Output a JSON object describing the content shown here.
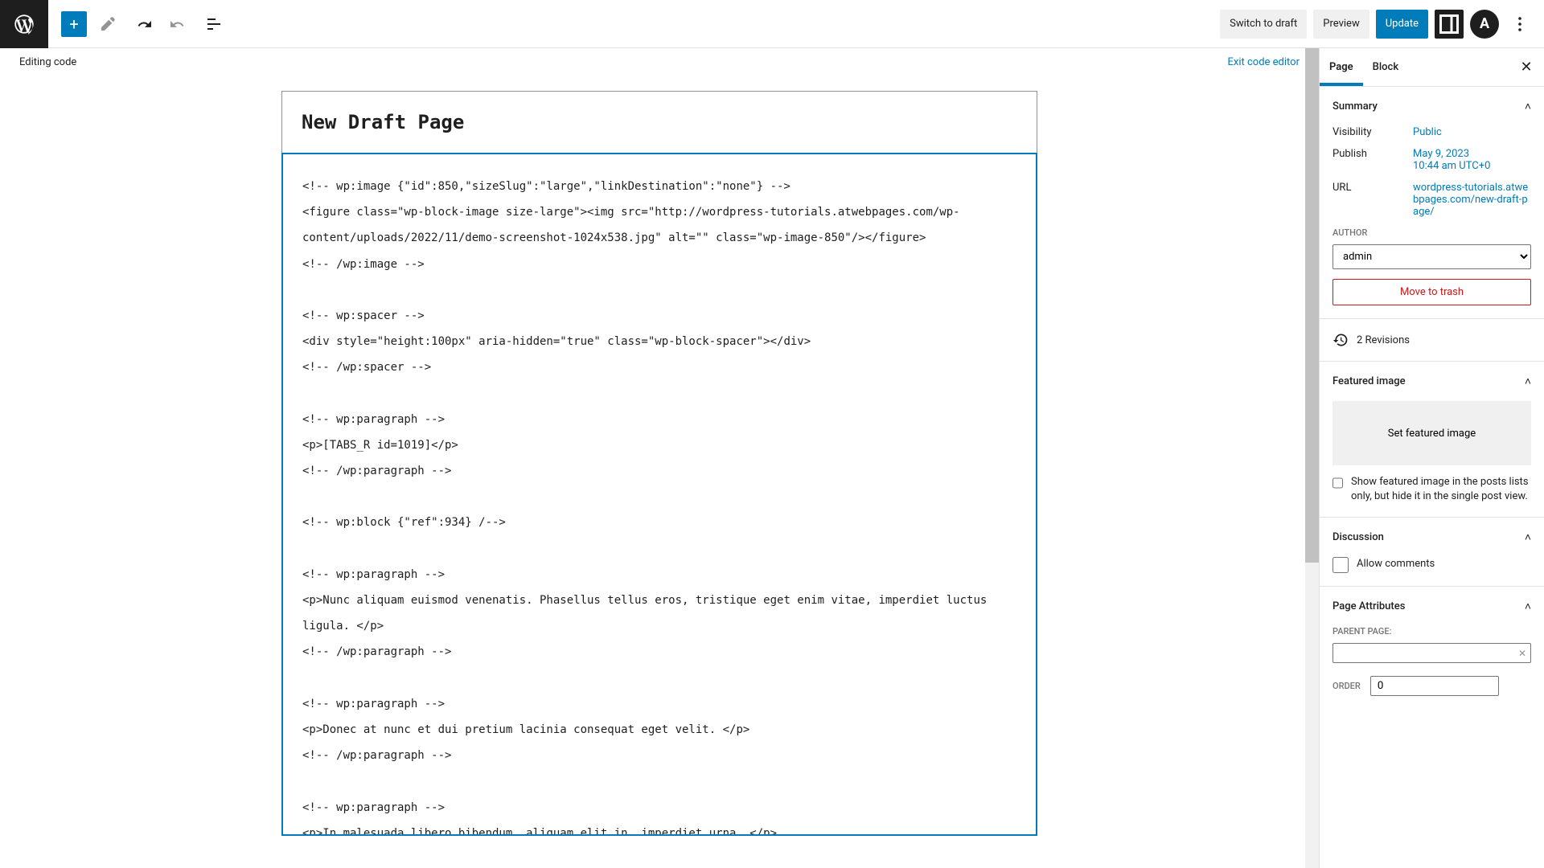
{
  "toolbar": {
    "switch_draft": "Switch to draft",
    "preview": "Preview",
    "update": "Update"
  },
  "editor": {
    "banner_left": "Editing code",
    "exit_link": "Exit code editor",
    "title": "New Draft Page",
    "code": "<!-- wp:image {\"id\":850,\"sizeSlug\":\"large\",\"linkDestination\":\"none\"} -->\n<figure class=\"wp-block-image size-large\"><img src=\"http://wordpress-tutorials.atwebpages.com/wp-content/uploads/2022/11/demo-screenshot-1024x538.jpg\" alt=\"\" class=\"wp-image-850\"/></figure>\n<!-- /wp:image -->\n\n<!-- wp:spacer -->\n<div style=\"height:100px\" aria-hidden=\"true\" class=\"wp-block-spacer\"></div>\n<!-- /wp:spacer -->\n\n<!-- wp:paragraph -->\n<p>[TABS_R id=1019]</p>\n<!-- /wp:paragraph -->\n\n<!-- wp:block {\"ref\":934} /-->\n\n<!-- wp:paragraph -->\n<p>Nunc aliquam euismod venenatis. Phasellus tellus eros, tristique eget enim vitae, imperdiet luctus ligula. </p>\n<!-- /wp:paragraph -->\n\n<!-- wp:paragraph -->\n<p>Donec at nunc et dui pretium lacinia consequat eget velit. </p>\n<!-- /wp:paragraph -->\n\n<!-- wp:paragraph -->\n<p>In malesuada libero bibendum, aliquam elit in, imperdiet urna. </p>\n<!-- /wp:paragraph -->"
  },
  "sidebar": {
    "tabs": {
      "page": "Page",
      "block": "Block"
    },
    "summary": {
      "heading": "Summary",
      "visibility_label": "Visibility",
      "visibility_value": "Public",
      "publish_label": "Publish",
      "publish_value": "May 9, 2023\n10:44 am UTC+0",
      "url_label": "URL",
      "url_value": "wordpress-tutorials.atwebpages.com/new-draft-page/",
      "author_label": "AUTHOR",
      "author_value": "admin",
      "trash": "Move to trash"
    },
    "revisions": "2 Revisions",
    "featured": {
      "heading": "Featured image",
      "button": "Set featured image",
      "checkbox": "Show featured image in the posts lists only, but hide it in the single post view."
    },
    "discussion": {
      "heading": "Discussion",
      "allow": "Allow comments"
    },
    "attributes": {
      "heading": "Page Attributes",
      "parent_label": "PARENT PAGE:",
      "order_label": "ORDER",
      "order_value": "0"
    }
  }
}
